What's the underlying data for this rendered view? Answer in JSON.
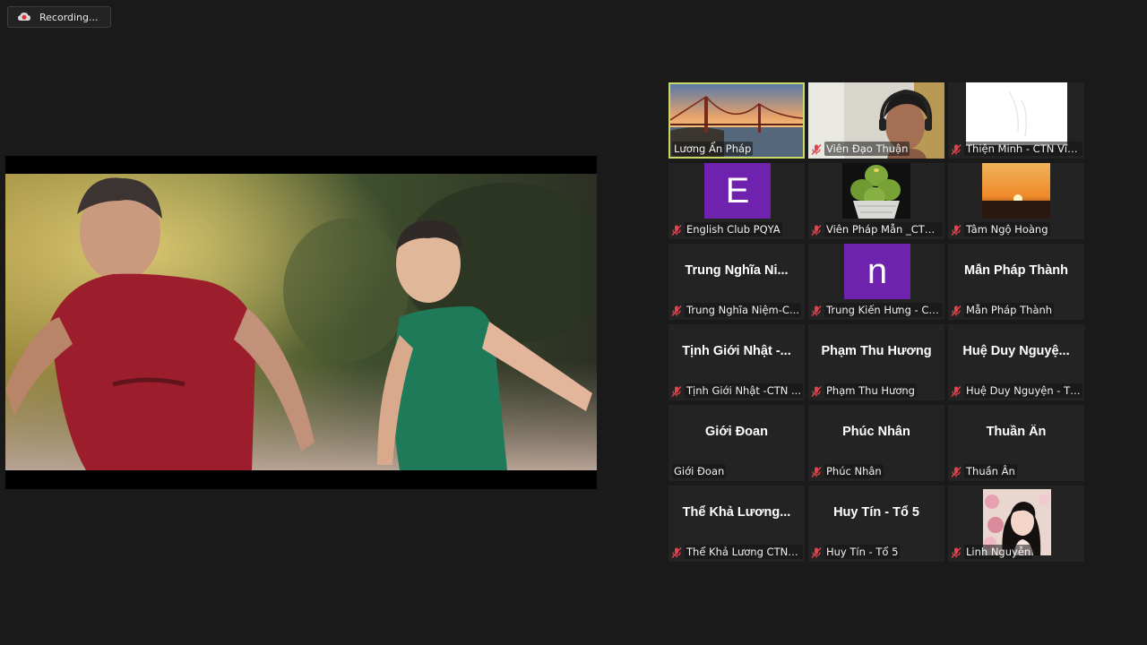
{
  "recording": {
    "label": "Recording..."
  },
  "participants": [
    {
      "name": "Lương Ẩn Pháp",
      "big_name": "",
      "muted": false,
      "active": true,
      "video": "bridge"
    },
    {
      "name": "Viên Đạo Thuận",
      "big_name": "",
      "muted": true,
      "active": false,
      "video": "woman-headset"
    },
    {
      "name": "Thiện Minh - CTN Vĩnh...",
      "big_name": "",
      "muted": true,
      "active": false,
      "video": "white-drawing"
    },
    {
      "name": "English Club PQYA",
      "big_name": "",
      "muted": true,
      "active": false,
      "avatar_letter": "E"
    },
    {
      "name": "Viên Pháp Mẫn _CTN ...",
      "big_name": "",
      "muted": true,
      "active": false,
      "video": "cactus"
    },
    {
      "name": "Tâm Ngộ Hoàng",
      "big_name": "",
      "muted": true,
      "active": false,
      "video": "sunset"
    },
    {
      "name": "Trung Nghĩa Niệm-C...",
      "big_name": "Trung Nghĩa Ni...",
      "muted": true,
      "active": false
    },
    {
      "name": "Trung Kiến Hưng - CT...",
      "big_name": "",
      "muted": true,
      "active": false,
      "avatar_letter": "n"
    },
    {
      "name": "Mẫn Pháp Thành",
      "big_name": "Mẫn Pháp Thành",
      "muted": true,
      "active": false
    },
    {
      "name": "Tịnh Giới Nhật -CTN ...",
      "big_name": "Tịnh Giới Nhật -...",
      "muted": true,
      "active": false
    },
    {
      "name": "Phạm Thu Hương",
      "big_name": "Phạm Thu Hương",
      "muted": true,
      "active": false
    },
    {
      "name": "Huệ Duy Nguyện - Tổ...",
      "big_name": "Huệ Duy Nguyệ...",
      "muted": true,
      "active": false
    },
    {
      "name": "Giới Đoan",
      "big_name": "Giới Đoan",
      "muted": false,
      "active": false
    },
    {
      "name": "Phúc Nhân",
      "big_name": "Phúc Nhân",
      "muted": true,
      "active": false
    },
    {
      "name": "Thuần Ân",
      "big_name": "Thuần Ân",
      "muted": true,
      "active": false
    },
    {
      "name": "Thể Khả Lương CTN-...",
      "big_name": "Thể Khả Lương...",
      "muted": true,
      "active": false
    },
    {
      "name": "Huy Tín - Tổ 5",
      "big_name": "Huy Tín - Tổ 5",
      "muted": true,
      "active": false
    },
    {
      "name": "Linh Nguyễn",
      "big_name": "",
      "muted": true,
      "active": false,
      "video": "girl-flowers"
    }
  ],
  "colors": {
    "background": "#1a1a1a",
    "tile": "#232323",
    "active_border": "#c9d868",
    "muted_icon": "#e0434b",
    "avatar_purple": "#6f22ad"
  }
}
